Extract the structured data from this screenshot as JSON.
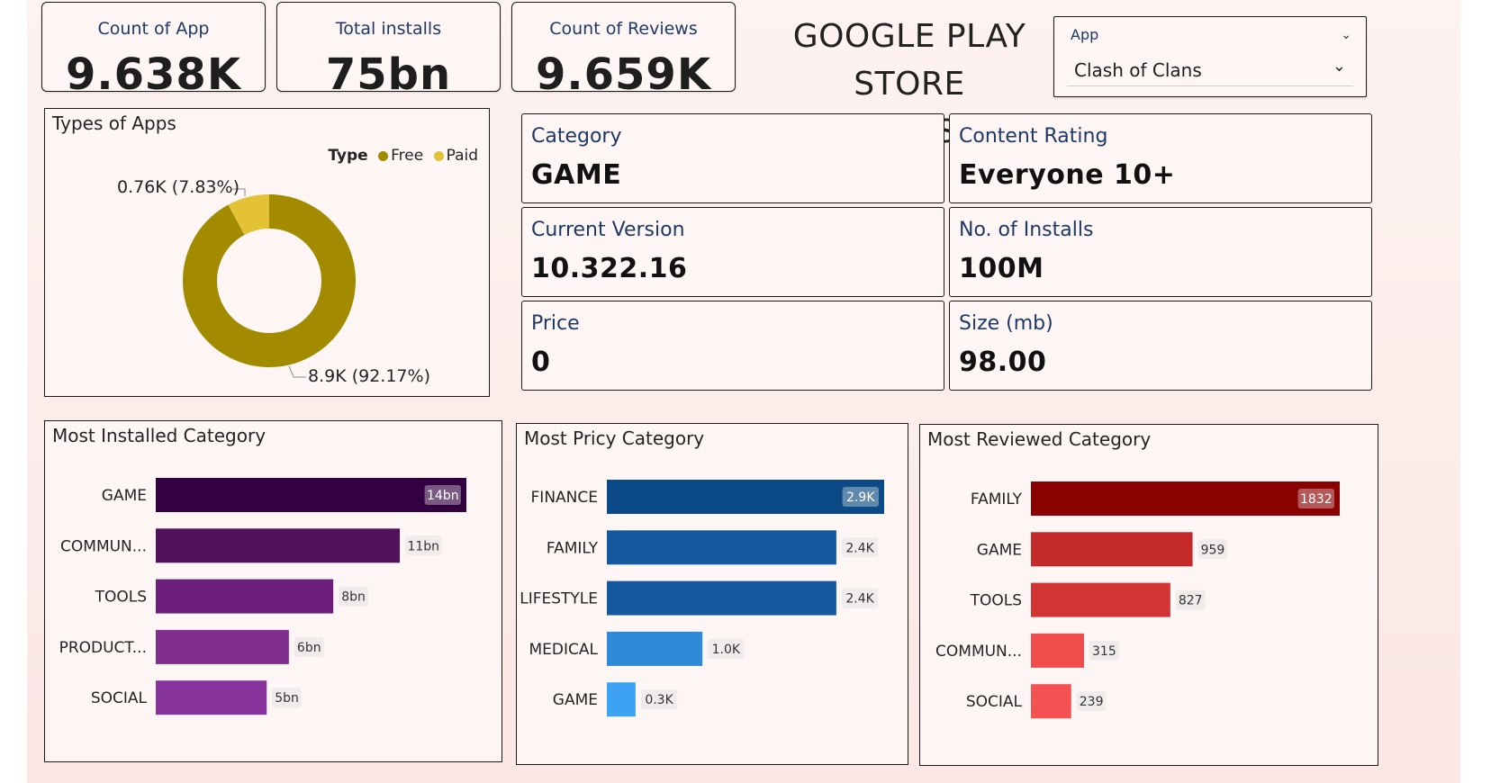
{
  "kpis": [
    {
      "label": "Count of App",
      "value": "9.638K"
    },
    {
      "label": "Total installs",
      "value": "75bn"
    },
    {
      "label": "Count of Reviews",
      "value": "9.659K"
    }
  ],
  "title_line1": "GOOGLE PLAY",
  "title_line2": "STORE ANALYSIS",
  "slicer": {
    "title": "App",
    "value": "Clash of Clans"
  },
  "types_of_apps": {
    "title": "Types of Apps",
    "legend_title": "Type",
    "paid_label": "0.76K (7.83%)",
    "free_label": "8.9K (92.17%)"
  },
  "info_cards": [
    {
      "label": "Category",
      "value": "GAME"
    },
    {
      "label": "Content Rating",
      "value": "Everyone 10+"
    },
    {
      "label": "Current Version",
      "value": "10.322.16"
    },
    {
      "label": "No. of Installs",
      "value": "100M"
    },
    {
      "label": "Price",
      "value": "0"
    },
    {
      "label": "Size (mb)",
      "value": "98.00"
    }
  ],
  "colors": {
    "free": "#a38b00",
    "paid": "#e4c235"
  },
  "chart_data": [
    {
      "type": "pie",
      "title": "Types of Apps",
      "legend_title": "Type",
      "categories": [
        "Free",
        "Paid"
      ],
      "values": [
        8.9,
        0.76
      ],
      "percent": [
        92.17,
        7.83
      ],
      "labels": [
        "8.9K (92.17%)",
        "0.76K (7.83%)"
      ],
      "legend": "top-right",
      "donut": true,
      "colors": [
        "#a38b00",
        "#e4c235"
      ]
    },
    {
      "type": "bar",
      "orientation": "horizontal",
      "title": "Most Installed Category",
      "categories": [
        "GAME",
        "COMMUN...",
        "TOOLS",
        "PRODUCT...",
        "SOCIAL"
      ],
      "values": [
        14,
        11,
        8,
        6,
        5
      ],
      "labels": [
        "14bn",
        "11bn",
        "8bn",
        "6bn",
        "5bn"
      ],
      "colors": [
        "#330040",
        "#520f5c",
        "#6b1f7b",
        "#7f2e8f",
        "#85329a"
      ]
    },
    {
      "type": "bar",
      "orientation": "horizontal",
      "title": "Most Pricy Category",
      "categories": [
        "FINANCE",
        "FAMILY",
        "LIFESTYLE",
        "MEDICAL",
        "GAME"
      ],
      "values": [
        2.9,
        2.4,
        2.4,
        1.0,
        0.3
      ],
      "labels": [
        "2.9K",
        "2.4K",
        "2.4K",
        "1.0K",
        "0.3K"
      ],
      "colors": [
        "#0b4a86",
        "#14599f",
        "#14599f",
        "#2e8ad8",
        "#3ea2f2"
      ]
    },
    {
      "type": "bar",
      "orientation": "horizontal",
      "title": "Most Reviewed Category",
      "categories": [
        "FAMILY",
        "GAME",
        "TOOLS",
        "COMMUN...",
        "SOCIAL"
      ],
      "values": [
        1832,
        959,
        827,
        315,
        239
      ],
      "labels": [
        "1832",
        "959",
        "827",
        "315",
        "239"
      ],
      "colors": [
        "#8b0000",
        "#c42a2a",
        "#d23434",
        "#f04c4c",
        "#f45252"
      ]
    }
  ]
}
